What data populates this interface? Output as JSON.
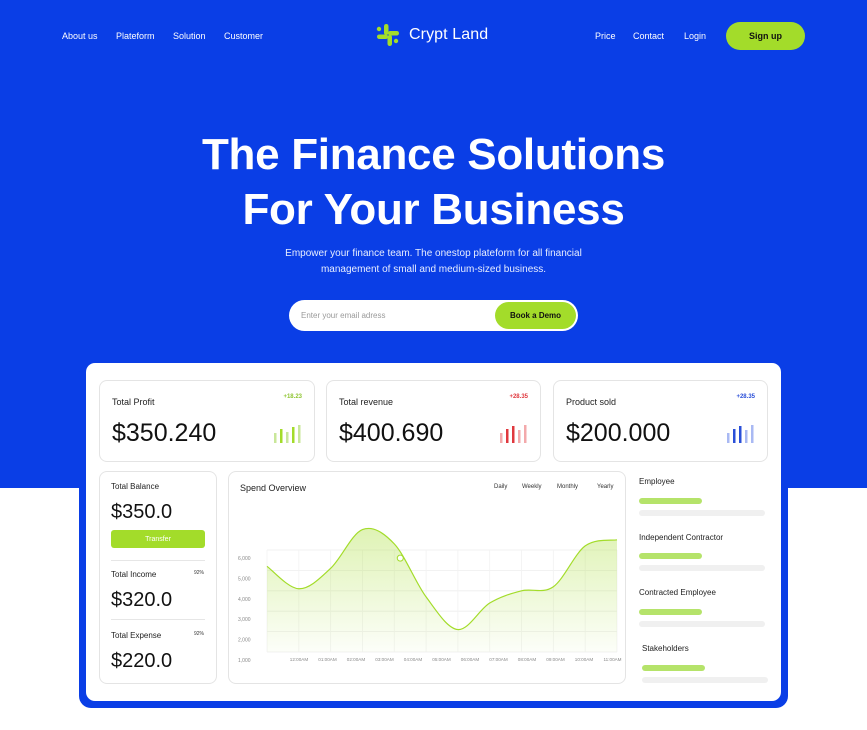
{
  "nav": {
    "left": [
      "About us",
      "Plateform",
      "Solution",
      "Customer"
    ],
    "brand": "Crypt Land",
    "right": [
      "Price",
      "Contact",
      "Login"
    ],
    "signup": "Sign up"
  },
  "hero": {
    "title_line1": "The Finance Solutions",
    "title_line2": "For Your Business",
    "subtitle_line1": "Empower your finance team. The onestop plateform for all financial",
    "subtitle_line2": "management of small and medium-sized business.",
    "email_placeholder": "Enter your email adress",
    "demo_button": "Book a Demo"
  },
  "stats": [
    {
      "title": "Total Profit",
      "change": "+18.23",
      "value": "$350.240",
      "color": "#8fc532"
    },
    {
      "title": "Total revenue",
      "change": "+28.35",
      "value": "$400.690",
      "color": "#e0383e"
    },
    {
      "title": "Product sold",
      "change": "+28.35",
      "value": "$200.000",
      "color": "#2a4fd8"
    }
  ],
  "balance": {
    "balance_label": "Total Balance",
    "balance_value": "$350.0",
    "transfer": "Transfer",
    "income_label": "Total Income",
    "income_pct": "92%",
    "income_value": "$320.0",
    "expense_label": "Total Expense",
    "expense_pct": "92%",
    "expense_value": "$220.0"
  },
  "spend": {
    "title": "Spend Overview",
    "tabs": [
      "Daily",
      "Weekly",
      "Monthly",
      "Yearly"
    ],
    "y_ticks": [
      "6,000",
      "5,000",
      "4,000",
      "3,000",
      "2,000",
      "1,000"
    ],
    "x_ticks": [
      "12:00AM",
      "01:00AM",
      "02:00AM",
      "03:00AM",
      "04:00AM",
      "05:00AM",
      "06:00AM",
      "07:00AM",
      "08:00AM",
      "09:00AM",
      "10:00AM",
      "11:00AM"
    ]
  },
  "chart_data": {
    "type": "area",
    "title": "Spend Overview",
    "x": [
      "12:00AM",
      "01:00AM",
      "02:00AM",
      "03:00AM",
      "04:00AM",
      "05:00AM",
      "06:00AM",
      "07:00AM",
      "08:00AM",
      "09:00AM",
      "10:00AM",
      "11:00AM"
    ],
    "ylim": [
      1000,
      6000
    ],
    "series": [
      {
        "values": [
          5200,
          4100,
          5100,
          7000,
          6300,
          3700,
          2100,
          3400,
          4000,
          4200,
          6200,
          6500
        ]
      }
    ],
    "grid": true,
    "color": "#a3dc2a"
  },
  "people": [
    {
      "label": "Employee",
      "fill": 0.5
    },
    {
      "label": "Independent Contractor",
      "fill": 0.5
    },
    {
      "label": "Contracted Employee",
      "fill": 0.5
    },
    {
      "label": "Stakeholders",
      "fill": 0.5
    }
  ],
  "colors": {
    "brand_blue": "#0a3ee6",
    "accent_green": "#a3dc2a"
  }
}
